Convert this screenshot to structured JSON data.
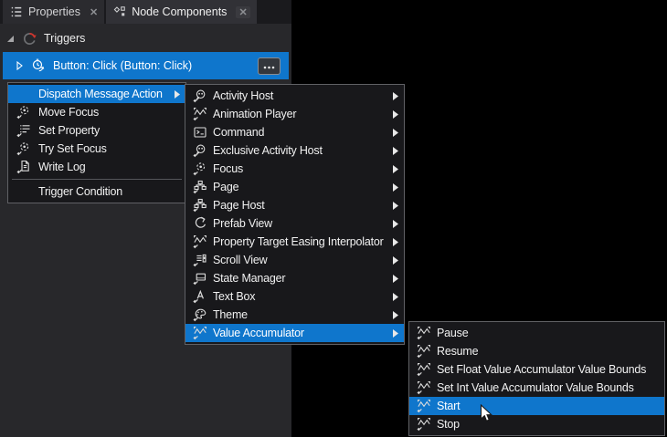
{
  "colors": {
    "highlight": "#0f76cc",
    "panel_bg": "#28282b",
    "tabbar_bg": "#1a1a1d",
    "tab_bg": "#2b2b2f",
    "tab_active_bg": "#313136",
    "menu_bg": "#18181b",
    "menu_border": "#606165",
    "trigger_red": "#d0342c"
  },
  "tabs": [
    {
      "label": "Properties",
      "icon": "properties",
      "close_label": "✕",
      "active": false
    },
    {
      "label": "Node Components",
      "icon": "node-components",
      "close_label": "✕",
      "active": true
    }
  ],
  "panel": {
    "triggers_header": {
      "label": "Triggers",
      "icon": "triggers"
    },
    "trigger_row": {
      "label": "Button: Click (Button: Click)",
      "icon": "button-click",
      "more_button_icon": "ellipsis"
    }
  },
  "context_menu": {
    "items": [
      {
        "label": "Dispatch Message Action",
        "submenu": true,
        "highlighted": true
      },
      {
        "label": "Move Focus",
        "icon": "focus"
      },
      {
        "label": "Set Property",
        "icon": "set-property"
      },
      {
        "label": "Try Set Focus",
        "icon": "focus"
      },
      {
        "label": "Write Log",
        "icon": "write-log"
      },
      {
        "separator": true
      },
      {
        "label": "Trigger Condition"
      }
    ]
  },
  "component_menu": {
    "items": [
      {
        "label": "Activity Host",
        "icon": "activity-host",
        "submenu": true
      },
      {
        "label": "Animation Player",
        "icon": "wave",
        "submenu": true
      },
      {
        "label": "Command",
        "icon": "command",
        "submenu": true
      },
      {
        "label": "Exclusive Activity Host",
        "icon": "activity-host",
        "submenu": true
      },
      {
        "label": "Focus",
        "icon": "focus",
        "submenu": true
      },
      {
        "label": "Page",
        "icon": "page",
        "submenu": true
      },
      {
        "label": "Page Host",
        "icon": "page",
        "submenu": true
      },
      {
        "label": "Prefab View",
        "icon": "prefab",
        "submenu": true
      },
      {
        "label": "Property Target Easing Interpolator",
        "icon": "wave",
        "submenu": true
      },
      {
        "label": "Scroll View",
        "icon": "scroll-view",
        "submenu": true
      },
      {
        "label": "State Manager",
        "icon": "state-manager",
        "submenu": true
      },
      {
        "label": "Text Box",
        "icon": "text-box",
        "submenu": true
      },
      {
        "label": "Theme",
        "icon": "theme",
        "submenu": true
      },
      {
        "label": "Value Accumulator",
        "icon": "wave",
        "submenu": true,
        "highlighted": true
      }
    ]
  },
  "action_menu": {
    "items": [
      {
        "label": "Pause",
        "icon": "wave"
      },
      {
        "label": "Resume",
        "icon": "wave"
      },
      {
        "label": "Set Float Value Accumulator Value Bounds",
        "icon": "wave"
      },
      {
        "label": "Set Int Value Accumulator Value Bounds",
        "icon": "wave"
      },
      {
        "label": "Start",
        "icon": "wave",
        "highlighted": true
      },
      {
        "label": "Stop",
        "icon": "wave"
      }
    ]
  }
}
